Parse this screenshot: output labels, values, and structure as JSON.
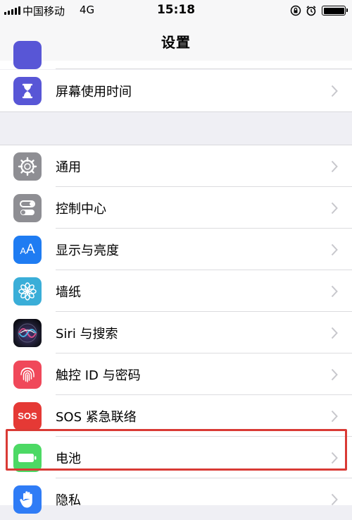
{
  "status_bar": {
    "carrier": "中国移动",
    "network": "4G",
    "time": "15:18"
  },
  "nav": {
    "title": "设置"
  },
  "top_group": [
    {
      "label": "屏幕使用时间",
      "icon": "hourglass-icon",
      "color": "#5856d6"
    }
  ],
  "main_group": [
    {
      "label": "通用",
      "icon": "gear-icon",
      "color": "#8e8e93"
    },
    {
      "label": "控制中心",
      "icon": "toggles-icon",
      "color": "#8e8e93"
    },
    {
      "label": "显示与亮度",
      "icon": "text-size-icon",
      "color": "#1f7cf2",
      "icon_text": "AA"
    },
    {
      "label": "墙纸",
      "icon": "flower-icon",
      "color": "#3aaed8"
    },
    {
      "label": "Siri 与搜索",
      "icon": "siri-icon",
      "color": "#111111"
    },
    {
      "label": "触控 ID 与密码",
      "icon": "fingerprint-icon",
      "color": "#f0485a"
    },
    {
      "label": "SOS 紧急联络",
      "icon": "sos-icon",
      "color": "#e53935",
      "icon_text": "SOS"
    },
    {
      "label": "电池",
      "icon": "battery-icon",
      "color": "#4cd964"
    },
    {
      "label": "隐私",
      "icon": "hand-icon",
      "color": "#2f7cf6"
    }
  ],
  "highlight_color": "#d93a35"
}
